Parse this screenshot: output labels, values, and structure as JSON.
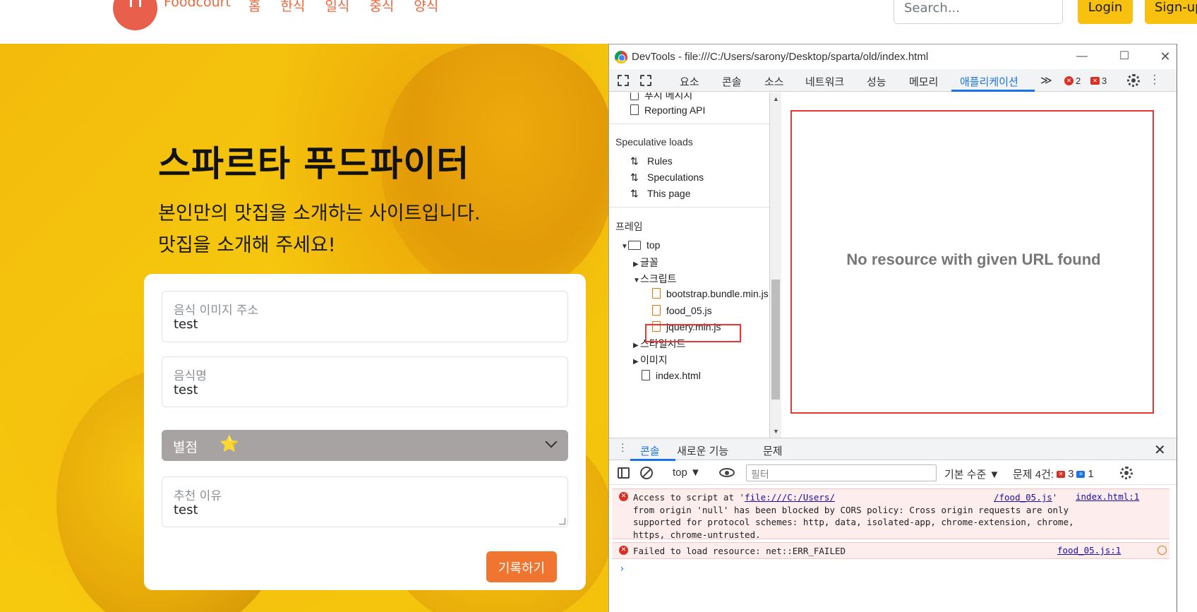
{
  "site": {
    "brand": "Foodcourt",
    "nav_links": [
      "홈",
      "한식",
      "일식",
      "중식",
      "양식"
    ],
    "search_placeholder": "Search...",
    "login": "Login",
    "signup": "Sign-up"
  },
  "hero": {
    "title": "스파르타 푸드파이터",
    "subtitle_line1": "본인만의 맛집을 소개하는 사이트입니다.",
    "subtitle_line2": "맛집을 소개해 주세요!"
  },
  "form": {
    "image_url": {
      "label": "음식 이미지 주소",
      "value": "test"
    },
    "food_name": {
      "label": "음식명",
      "value": "test"
    },
    "rating": {
      "label": "별점",
      "star": "⭐"
    },
    "reason": {
      "label": "추천 이유",
      "value": "test"
    },
    "submit": "기록하기"
  },
  "devtools": {
    "title": "DevTools - file:///C:/Users/sarony/Desktop/sparta/old/index.html",
    "window_controls": {
      "minimize": "—",
      "maximize": "☐",
      "close": "✕"
    },
    "tabs": [
      "요소",
      "콘솔",
      "소스",
      "네트워크",
      "성능",
      "메모리",
      "애플리케이션"
    ],
    "active_tab": "애플리케이션",
    "more_tabs": "≫",
    "error_count": "2",
    "warning_count": "3",
    "sidebar": {
      "top_items": [
        "푸시 메시지",
        "Reporting API"
      ],
      "speculative_title": "Speculative loads",
      "speculative_items": [
        "Rules",
        "Speculations",
        "This page"
      ],
      "frames_title": "프레임",
      "frame_top": "top",
      "fonts": "글꼴",
      "scripts": "스크립트",
      "script_files": [
        "bootstrap.bundle.min.js",
        "food_05.js",
        "jquery.min.js"
      ],
      "stylesheets": "스타일시트",
      "images": "이미지",
      "index_file": "index.html"
    },
    "main_message": "No resource with given URL found",
    "drawer": {
      "tabs": [
        "콘솔",
        "새로운 기능",
        "문제"
      ],
      "close": "✕"
    },
    "console_toolbar": {
      "context": "top ▼",
      "filter_placeholder": "필터",
      "level": "기본 수준 ▼",
      "issues_label": "문제 4건:",
      "issues_red": "3",
      "issues_blue": "1"
    },
    "messages": {
      "m1_prefix": "Access to script at '",
      "m1_link_a": "file:///C:/Users/",
      "m1_link_b": "/food_05.js",
      "m1_line1_end": "'",
      "m1_line2": "from origin 'null' has been blocked by CORS policy: Cross origin requests are only",
      "m1_line3": "supported for protocol schemes: http, data, isolated-app, chrome-extension, chrome,",
      "m1_line4": "https, chrome-untrusted.",
      "m1_source": "index.html:1",
      "m2_text": "Failed to load resource: net::ERR_FAILED",
      "m2_source": "food_05.js:1",
      "prompt": "›"
    }
  }
}
